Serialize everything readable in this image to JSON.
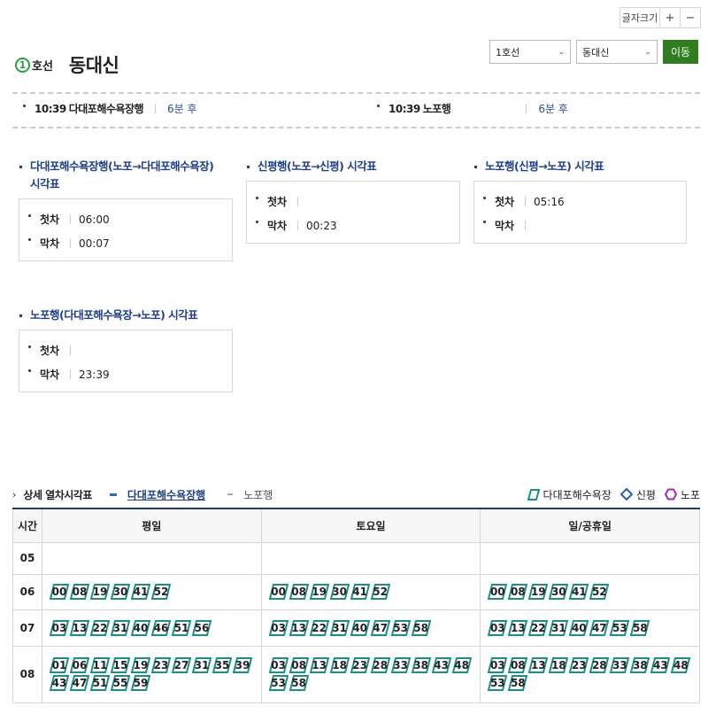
{
  "font_controls": {
    "label": "글자크기",
    "plus": "+",
    "minus": "−"
  },
  "title": {
    "line_number": "1",
    "line_suffix": "호선",
    "station": "동대신"
  },
  "selectors": {
    "line_value": "1호선",
    "station_value": "동대신",
    "go_label": "이동"
  },
  "arrivals": [
    {
      "time": "10:39",
      "dest": "다대포해수욕장행",
      "remain": "6분 후"
    },
    {
      "time": "10:39",
      "dest": "노포행",
      "remain": "6분 후"
    }
  ],
  "timetables": [
    {
      "title_line1": "다대포해수욕장행(노포→다대포해수욕장)",
      "title_line2": "시각표",
      "first_label": "첫차",
      "first": "06:00",
      "last_label": "막차",
      "last": "00:07"
    },
    {
      "title_line1": "신평행(노포→신평) 시각표",
      "title_line2": "",
      "first_label": "첫차",
      "first": "",
      "last_label": "막차",
      "last": "00:23"
    },
    {
      "title_line1": "노포행(신평→노포) 시각표",
      "title_line2": "",
      "first_label": "첫차",
      "first": "05:16",
      "last_label": "막차",
      "last": ""
    },
    {
      "title_line1": "노포행(다대포해수욕장→노포) 시각표",
      "title_line2": "",
      "first_label": "첫차",
      "first": "",
      "last_label": "막차",
      "last": "23:39"
    }
  ],
  "detail": {
    "title": "상세 열차시각표",
    "tab_active": "다대포해수욕장행",
    "tab_inactive": "노포행",
    "legend": [
      {
        "label": "다대포해수욕장",
        "shape": "parallelogram-icon",
        "color": "#1a8f8a"
      },
      {
        "label": "신평",
        "shape": "diamond-icon",
        "color": "#2a5fb0"
      },
      {
        "label": "노포",
        "shape": "hexagon-icon",
        "color": "#9b2bc0"
      }
    ]
  },
  "schedule": {
    "headers": [
      "시간",
      "평일",
      "토요일",
      "일/공휴일"
    ],
    "rows": [
      {
        "hour": "05",
        "weekday": [],
        "saturday": [],
        "holiday": []
      },
      {
        "hour": "06",
        "weekday": [
          "00",
          "08",
          "19",
          "30",
          "41",
          "52"
        ],
        "saturday": [
          "00",
          "08",
          "19",
          "30",
          "41",
          "52"
        ],
        "holiday": [
          "00",
          "08",
          "19",
          "30",
          "41",
          "52"
        ]
      },
      {
        "hour": "07",
        "weekday": [
          "03",
          "13",
          "22",
          "31",
          "40",
          "46",
          "51",
          "56"
        ],
        "saturday": [
          "03",
          "13",
          "22",
          "31",
          "40",
          "47",
          "53",
          "58"
        ],
        "holiday": [
          "03",
          "13",
          "22",
          "31",
          "40",
          "47",
          "53",
          "58"
        ]
      },
      {
        "hour": "08",
        "weekday": [
          "01",
          "06",
          "11",
          "15",
          "19",
          "23",
          "27",
          "31",
          "35",
          "39",
          "43",
          "47",
          "51",
          "55",
          "59"
        ],
        "saturday": [
          "03",
          "08",
          "13",
          "18",
          "23",
          "28",
          "33",
          "38",
          "43",
          "48",
          "53",
          "58"
        ],
        "holiday": [
          "03",
          "08",
          "13",
          "18",
          "23",
          "28",
          "33",
          "38",
          "43",
          "48",
          "53",
          "58"
        ]
      }
    ]
  },
  "colors": {
    "accent": "#1d3f8e",
    "go_button": "#2e7d1f",
    "line1": "#2b9f3b",
    "minute_outline": "#1a8f8a"
  }
}
